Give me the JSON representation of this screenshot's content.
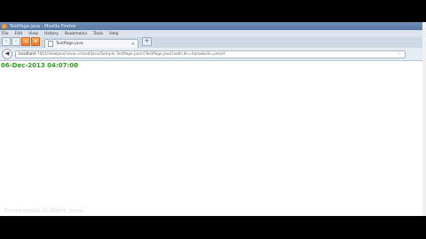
{
  "window": {
    "title": "TestPage.java - Mozilla Firefox"
  },
  "menu": {
    "file": "File",
    "edit": "Edit",
    "view": "View",
    "history": "History",
    "bookmarks": "Bookmarks",
    "tools": "Tools",
    "help": "Help"
  },
  "tab": {
    "title": "TestPage.java"
  },
  "url": {
    "host": "localhost",
    "path": ":7001/ViewJava?view=mood/Java/Sample.TestPage.java?/TestPage.java?auth-dir=home&sfx=jesort"
  },
  "content": {
    "time_text": "06-Dec-2013 04:07:00"
  },
  "watermark": "Screencast-O-Matic.com"
}
